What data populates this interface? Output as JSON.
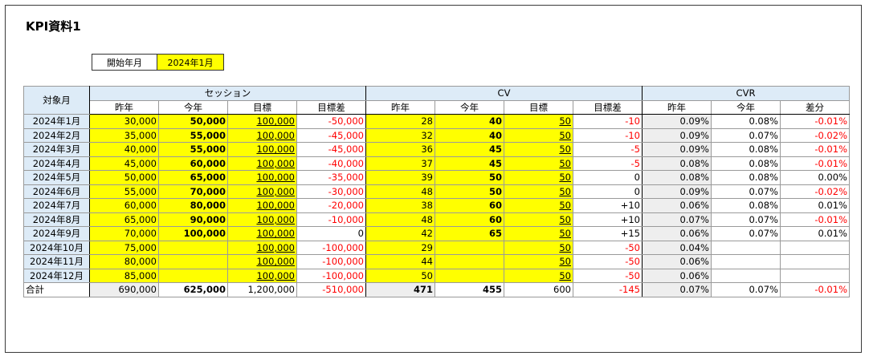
{
  "title": "KPI資料1",
  "start": {
    "label": "開始年月",
    "value": "2024年1月"
  },
  "headers": {
    "month": "対象月",
    "session": "セッション",
    "cv": "CV",
    "cvr": "CVR",
    "session_cols": [
      "昨年",
      "今年",
      "目標",
      "目標差"
    ],
    "cv_cols": [
      "昨年",
      "今年",
      "目標",
      "目標差"
    ],
    "cvr_cols": [
      "昨年",
      "今年",
      "差分"
    ]
  },
  "rows": [
    {
      "month": "2024年1月",
      "s_ly": "30,000",
      "s_ty": "50,000",
      "s_goal": "100,000",
      "s_diff": "-50,000",
      "c_ly": "28",
      "c_ty": "40",
      "c_goal": "50",
      "c_diff": "-10",
      "r_ly": "0.09%",
      "r_ty": "0.08%",
      "r_diff": "-0.01%"
    },
    {
      "month": "2024年2月",
      "s_ly": "35,000",
      "s_ty": "55,000",
      "s_goal": "100,000",
      "s_diff": "-45,000",
      "c_ly": "32",
      "c_ty": "40",
      "c_goal": "50",
      "c_diff": "-10",
      "r_ly": "0.09%",
      "r_ty": "0.07%",
      "r_diff": "-0.02%"
    },
    {
      "month": "2024年3月",
      "s_ly": "40,000",
      "s_ty": "55,000",
      "s_goal": "100,000",
      "s_diff": "-45,000",
      "c_ly": "36",
      "c_ty": "45",
      "c_goal": "50",
      "c_diff": "-5",
      "r_ly": "0.09%",
      "r_ty": "0.08%",
      "r_diff": "-0.01%"
    },
    {
      "month": "2024年4月",
      "s_ly": "45,000",
      "s_ty": "60,000",
      "s_goal": "100,000",
      "s_diff": "-40,000",
      "c_ly": "37",
      "c_ty": "45",
      "c_goal": "50",
      "c_diff": "-5",
      "r_ly": "0.08%",
      "r_ty": "0.08%",
      "r_diff": "-0.01%"
    },
    {
      "month": "2024年5月",
      "s_ly": "50,000",
      "s_ty": "65,000",
      "s_goal": "100,000",
      "s_diff": "-35,000",
      "c_ly": "39",
      "c_ty": "50",
      "c_goal": "50",
      "c_diff": "0",
      "r_ly": "0.08%",
      "r_ty": "0.08%",
      "r_diff": "0.00%"
    },
    {
      "month": "2024年6月",
      "s_ly": "55,000",
      "s_ty": "70,000",
      "s_goal": "100,000",
      "s_diff": "-30,000",
      "c_ly": "48",
      "c_ty": "50",
      "c_goal": "50",
      "c_diff": "0",
      "r_ly": "0.09%",
      "r_ty": "0.07%",
      "r_diff": "-0.02%"
    },
    {
      "month": "2024年7月",
      "s_ly": "60,000",
      "s_ty": "80,000",
      "s_goal": "100,000",
      "s_diff": "-20,000",
      "c_ly": "38",
      "c_ty": "60",
      "c_goal": "50",
      "c_diff": "+10",
      "r_ly": "0.06%",
      "r_ty": "0.08%",
      "r_diff": "0.01%"
    },
    {
      "month": "2024年8月",
      "s_ly": "65,000",
      "s_ty": "90,000",
      "s_goal": "100,000",
      "s_diff": "-10,000",
      "c_ly": "48",
      "c_ty": "60",
      "c_goal": "50",
      "c_diff": "+10",
      "r_ly": "0.07%",
      "r_ty": "0.07%",
      "r_diff": "-0.01%"
    },
    {
      "month": "2024年9月",
      "s_ly": "70,000",
      "s_ty": "100,000",
      "s_goal": "100,000",
      "s_diff": "0",
      "c_ly": "42",
      "c_ty": "65",
      "c_goal": "50",
      "c_diff": "+15",
      "r_ly": "0.06%",
      "r_ty": "0.07%",
      "r_diff": "0.01%"
    },
    {
      "month": "2024年10月",
      "s_ly": "75,000",
      "s_ty": "",
      "s_goal": "100,000",
      "s_diff": "-100,000",
      "c_ly": "29",
      "c_ty": "",
      "c_goal": "50",
      "c_diff": "-50",
      "r_ly": "0.04%",
      "r_ty": "",
      "r_diff": ""
    },
    {
      "month": "2024年11月",
      "s_ly": "80,000",
      "s_ty": "",
      "s_goal": "100,000",
      "s_diff": "-100,000",
      "c_ly": "44",
      "c_ty": "",
      "c_goal": "50",
      "c_diff": "-50",
      "r_ly": "0.06%",
      "r_ty": "",
      "r_diff": ""
    },
    {
      "month": "2024年12月",
      "s_ly": "85,000",
      "s_ty": "",
      "s_goal": "100,000",
      "s_diff": "-100,000",
      "c_ly": "50",
      "c_ty": "",
      "c_goal": "50",
      "c_diff": "-50",
      "r_ly": "0.06%",
      "r_ty": "",
      "r_diff": ""
    }
  ],
  "total": {
    "month": "合計",
    "s_ly": "690,000",
    "s_ty": "625,000",
    "s_goal": "1,200,000",
    "s_diff": "-510,000",
    "c_ly": "471",
    "c_ty": "455",
    "c_goal": "600",
    "c_diff": "-145",
    "r_ly": "0.07%",
    "r_ty": "0.07%",
    "r_diff": "-0.01%"
  }
}
